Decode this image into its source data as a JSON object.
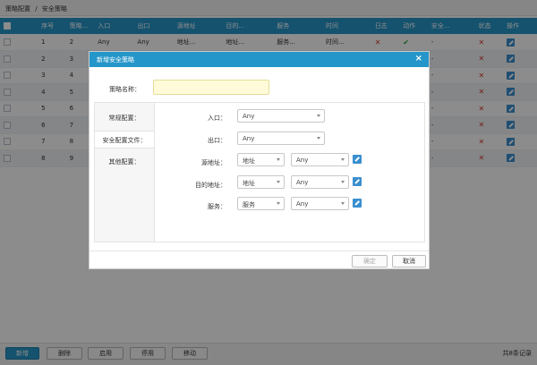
{
  "breadcrumb": [
    "策略配置",
    "/",
    "安全策略"
  ],
  "table": {
    "headers": [
      "序号",
      "策略...",
      "入口",
      "出口",
      "源地址",
      "目的...",
      "服务",
      "时间",
      "日志",
      "动作",
      "安全...",
      "状态",
      "操作"
    ],
    "rows": [
      {
        "seq": "1",
        "pol": "2",
        "in": "Any",
        "out": "Any",
        "src": "地址...",
        "dst": "地址...",
        "svc": "服务...",
        "time": "时间..."
      },
      {
        "seq": "2",
        "pol": "3"
      },
      {
        "seq": "3",
        "pol": "4"
      },
      {
        "seq": "4",
        "pol": "5"
      },
      {
        "seq": "5",
        "pol": "6"
      },
      {
        "seq": "6",
        "pol": "7"
      },
      {
        "seq": "7",
        "pol": "8"
      },
      {
        "seq": "8",
        "pol": "9"
      }
    ],
    "dash": "-"
  },
  "toolbar": {
    "new_label": "新增",
    "delete_label": "删除",
    "enable_label": "启用",
    "disable_label": "停用",
    "move_label": "移动",
    "record_count": "共8条记录"
  },
  "modal": {
    "title": "新增安全策略",
    "close": "×",
    "name_label": "策略名称：",
    "name_value": "",
    "tabs": [
      "常规配置：",
      "安全配置文件：",
      "其他配置："
    ],
    "fields": {
      "in_label": "入口：",
      "in_value": "Any",
      "out_label": "出口：",
      "out_value": "Any",
      "src_label": "源地址：",
      "src_type": "地址",
      "src_value": "Any",
      "dst_label": "目的地址：",
      "dst_type": "地址",
      "dst_value": "Any",
      "svc_label": "服务：",
      "svc_type": "服务",
      "svc_value": "Any"
    },
    "confirm_label": "确定",
    "cancel_label": "取消"
  },
  "colors": {
    "accent": "#2596c9",
    "error": "#d9382e",
    "ok": "#2ea43a"
  }
}
